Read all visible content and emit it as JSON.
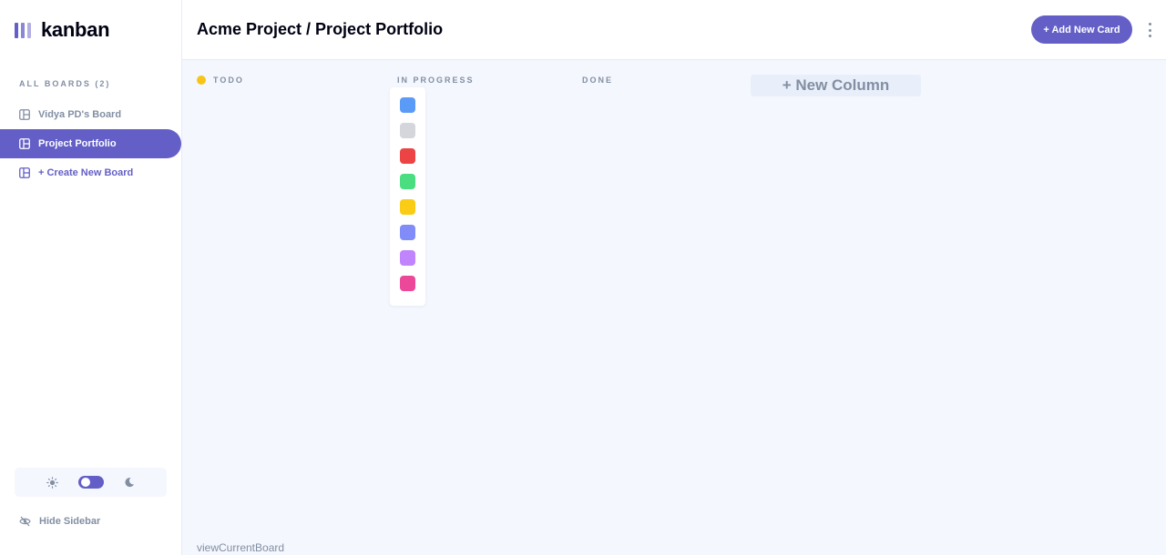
{
  "app": {
    "logo_text": "kanban"
  },
  "sidebar": {
    "heading": "ALL BOARDS (2)",
    "items": [
      {
        "label": "Vidya PD's Board",
        "active": false
      },
      {
        "label": "Project Portfolio",
        "active": true
      },
      {
        "label": "+ Create New Board",
        "active": false
      }
    ],
    "hide_label": "Hide Sidebar",
    "theme_toggle": {
      "light_icon": "sun-icon",
      "dark_icon": "moon-icon"
    }
  },
  "header": {
    "title": "Acme Project / Project Portfolio",
    "add_button": "+ Add New Card",
    "menu_icon": "vertical-ellipsis-icon"
  },
  "board": {
    "columns": [
      {
        "name": "TODO",
        "dot_color": "#f5c518"
      },
      {
        "name": "IN PROGRESS"
      },
      {
        "name": "DONE"
      }
    ],
    "new_column_label": "+ New Column",
    "color_options": [
      "#5b9bf8",
      "#d4d6dc",
      "#ec4444",
      "#4ade80",
      "#facc15",
      "#818cf8",
      "#c084fc",
      "#ec4899"
    ]
  },
  "footer": {
    "text": "viewCurrentBoard"
  },
  "colors": {
    "accent": "#635fc7",
    "muted": "#828fa3",
    "background": "#f4f7fd"
  }
}
